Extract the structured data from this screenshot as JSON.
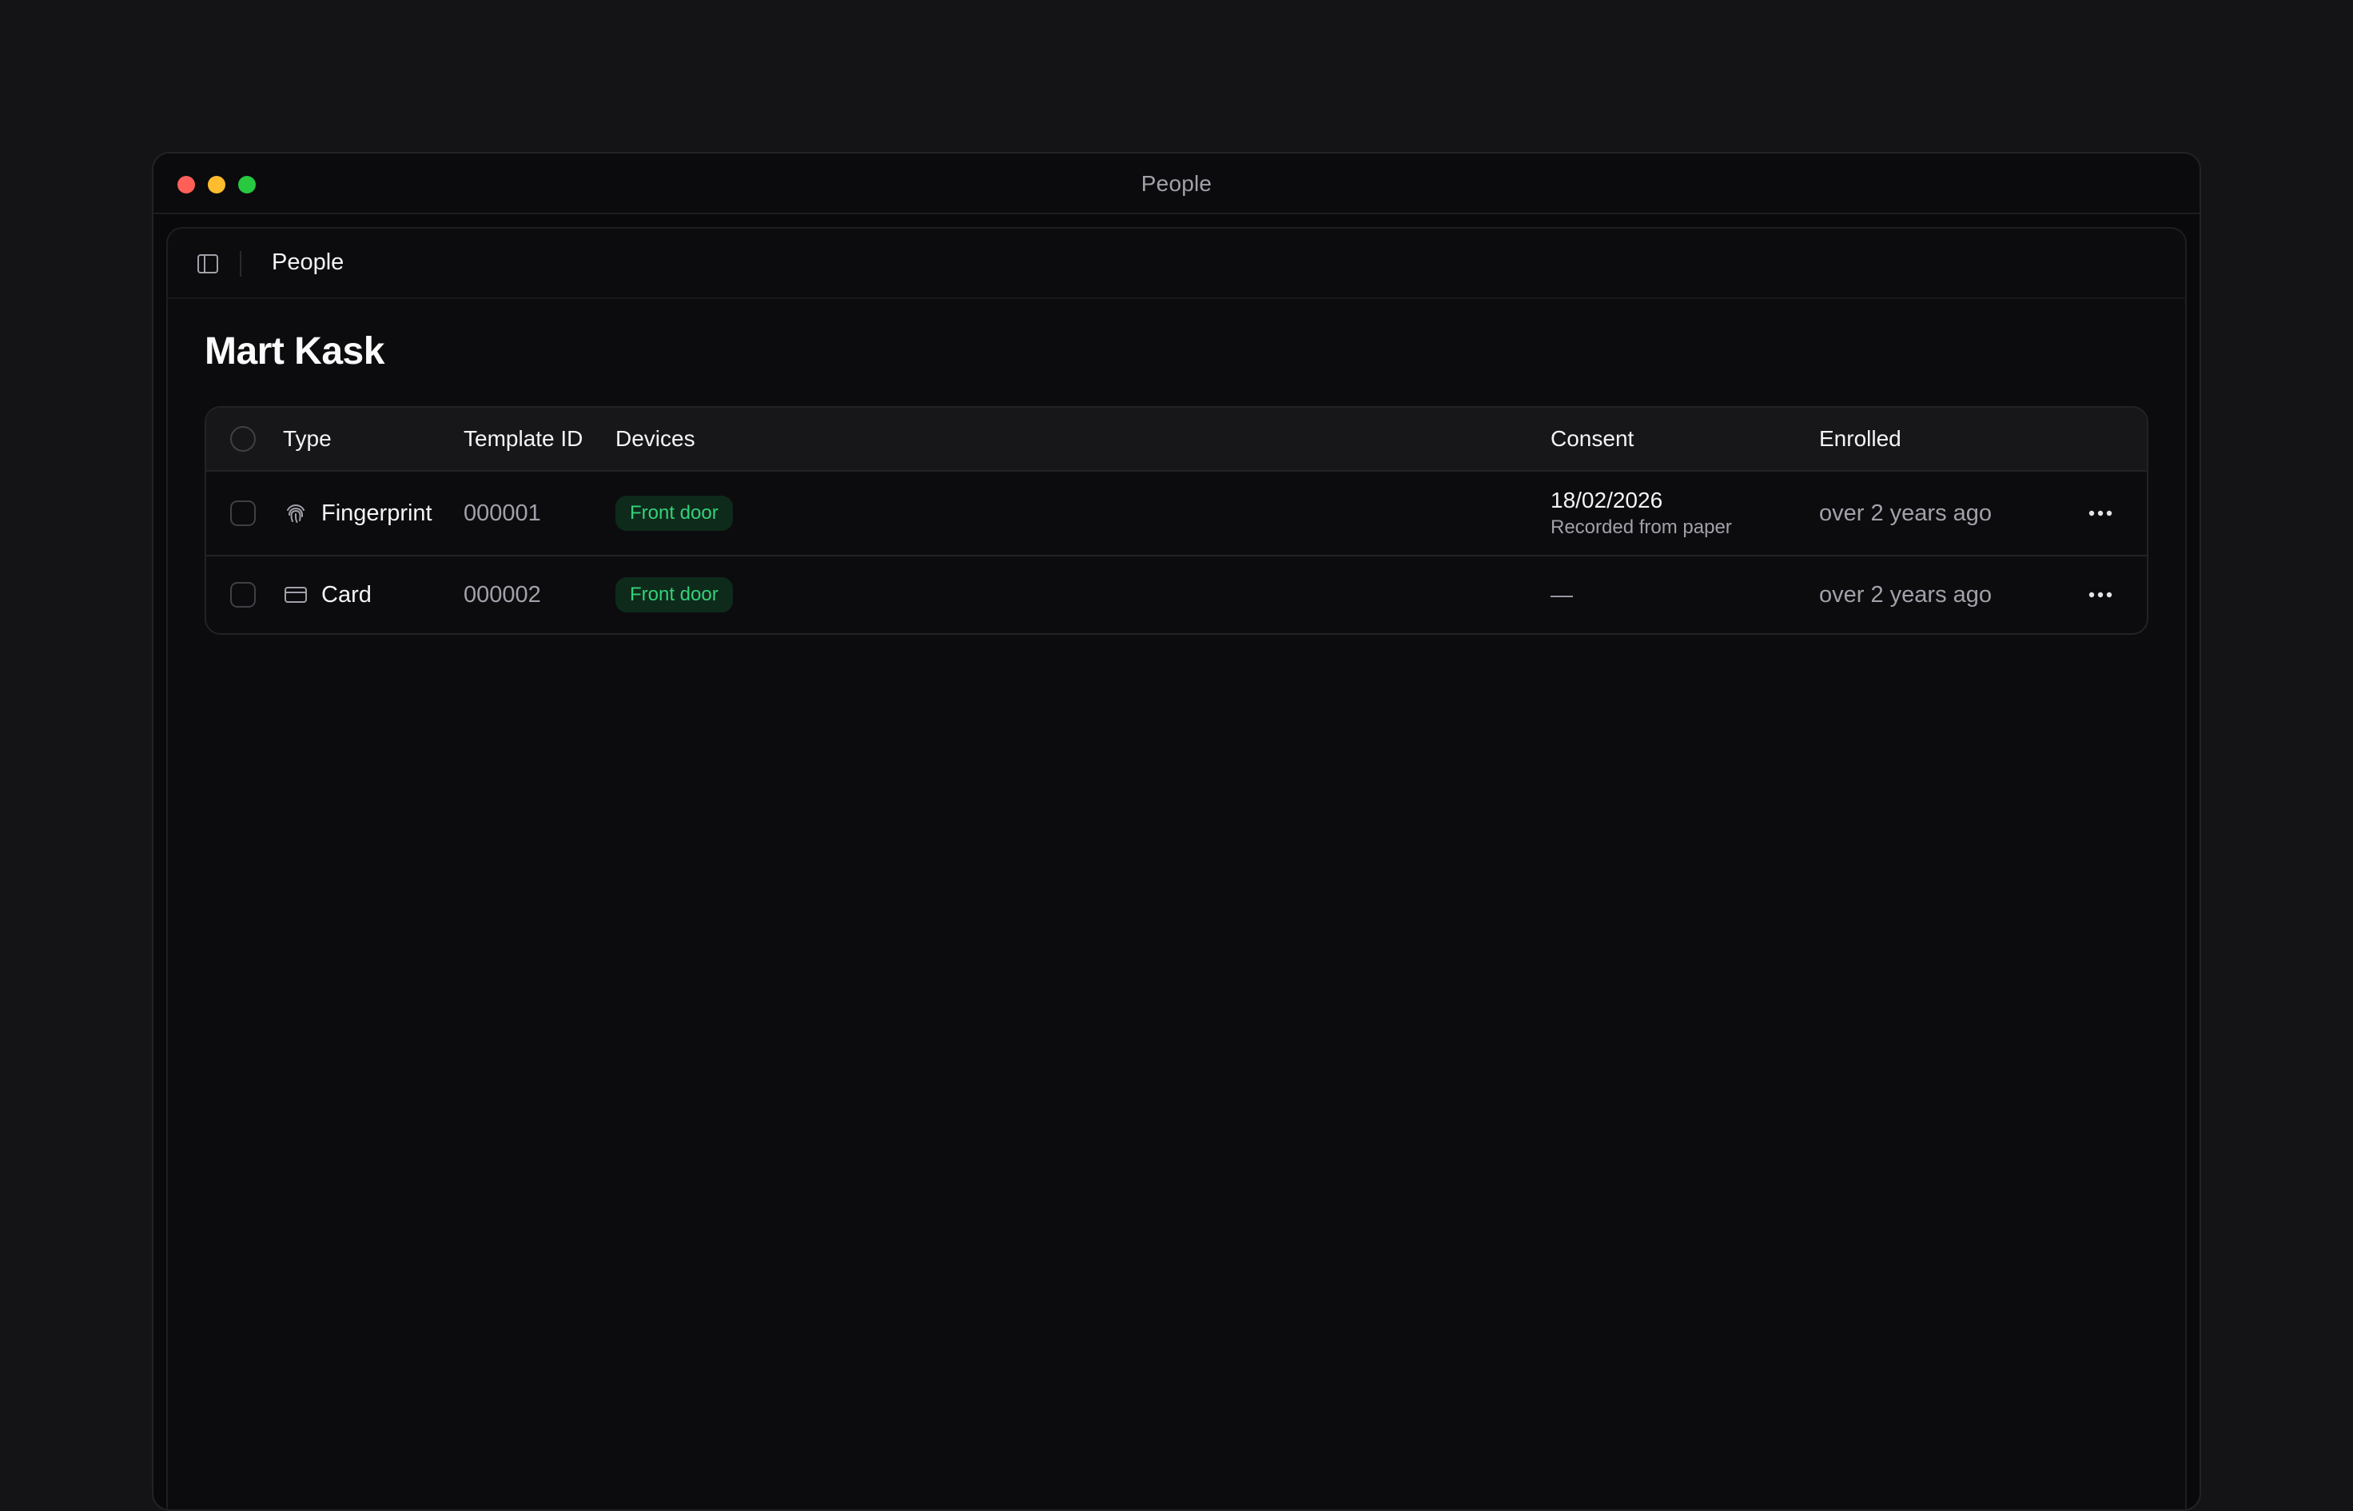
{
  "window": {
    "title": "People",
    "colors": {
      "close": "#ff5f57",
      "minimize": "#febc2e",
      "maximize": "#28c840"
    }
  },
  "topbar": {
    "toggle_icon": "sidebar-icon",
    "breadcrumb": "People"
  },
  "page": {
    "title": "Mart Kask"
  },
  "table": {
    "headers": {
      "type": "Type",
      "template_id": "Template ID",
      "devices": "Devices",
      "consent": "Consent",
      "enrolled": "Enrolled"
    },
    "rows": [
      {
        "type": "Fingerprint",
        "type_icon": "fingerprint-icon",
        "template_id": "000001",
        "device": "Front door",
        "consent_date": "18/02/2026",
        "consent_note": "Recorded from paper",
        "enrolled": "over 2 years ago",
        "more_icon": "ellipsis-icon"
      },
      {
        "type": "Card",
        "type_icon": "card-icon",
        "template_id": "000002",
        "device": "Front door",
        "consent_date": "—",
        "enrolled": "over 2 years ago",
        "more_icon": "ellipsis-icon"
      }
    ]
  },
  "colors": {
    "badge_bg": "#0e2a1b",
    "badge_text": "#34d17a"
  }
}
